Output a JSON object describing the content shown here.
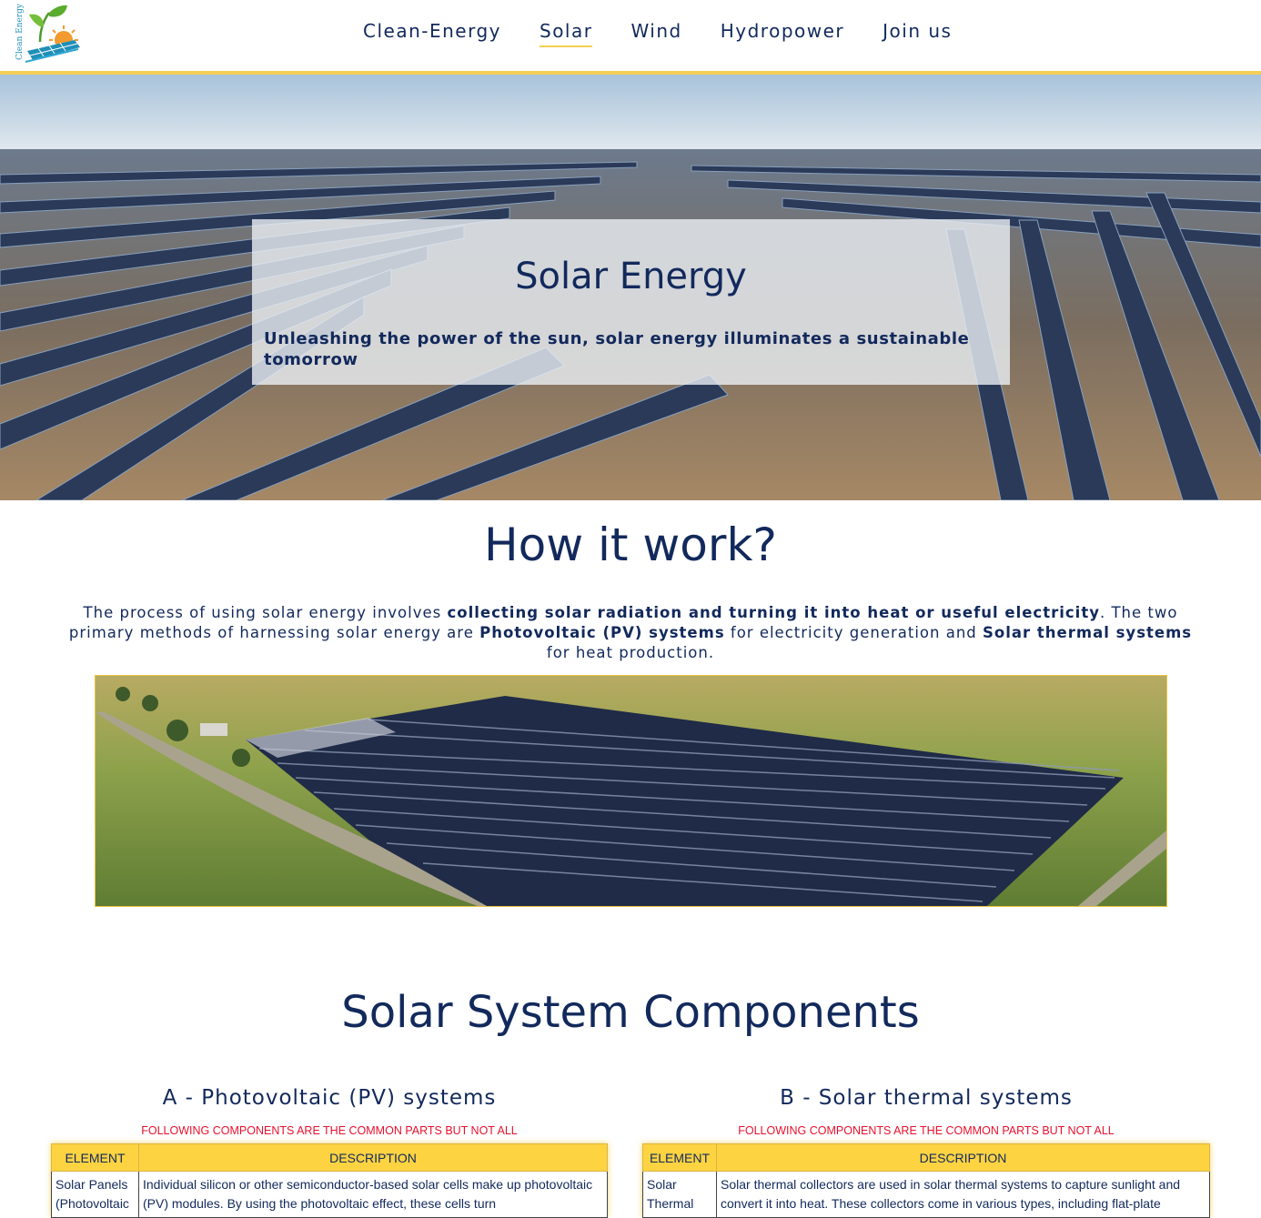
{
  "header": {
    "logo_alt": "Clean Energy",
    "nav": [
      {
        "label": "Clean-Energy",
        "active": false
      },
      {
        "label": "Solar",
        "active": true
      },
      {
        "label": "Wind",
        "active": false
      },
      {
        "label": "Hydropower",
        "active": false
      },
      {
        "label": "Join us",
        "active": false
      }
    ]
  },
  "hero": {
    "title": "Solar Energy",
    "subtitle": "Unleashing the power of the sun, solar energy illuminates a sustainable tomorrow"
  },
  "how": {
    "title": "How it work?",
    "text_1": "The process of using solar energy involves ",
    "text_bold_1": "collecting solar radiation and turning it into heat or useful electricity",
    "text_2": ". The two primary methods of harnessing solar energy are ",
    "text_bold_2": "Photovoltaic (PV) systems",
    "text_3": " for electricity generation and ",
    "text_bold_3": "Solar thermal systems",
    "text_4": " for heat production."
  },
  "components": {
    "title": "Solar System Components",
    "pv": {
      "title": "A - Photovoltaic (PV) systems",
      "notice": "FOLLOWING COMPONENTS ARE THE COMMON PARTS BUT NOT ALL",
      "col_element": "ELEMENT",
      "col_description": "DESCRIPTION",
      "row_element": "Solar Panels (Photovoltaic",
      "row_description": "Individual silicon or other semiconductor-based solar cells make up photovoltaic (PV) modules. By using the photovoltaic effect, these cells turn"
    },
    "thermal": {
      "title": "B - Solar thermal systems",
      "notice": "FOLLOWING COMPONENTS ARE THE COMMON PARTS BUT NOT ALL",
      "col_element": "ELEMENT",
      "col_description": "DESCRIPTION",
      "row_element": "Solar Thermal",
      "row_description": "Solar thermal collectors are used in solar thermal systems to capture sunlight and convert it into heat. These collectors come in various types, including flat-plate"
    }
  },
  "colors": {
    "navy": "#12295c",
    "accent_yellow": "#fdd342",
    "notice_red": "#e8112d"
  }
}
